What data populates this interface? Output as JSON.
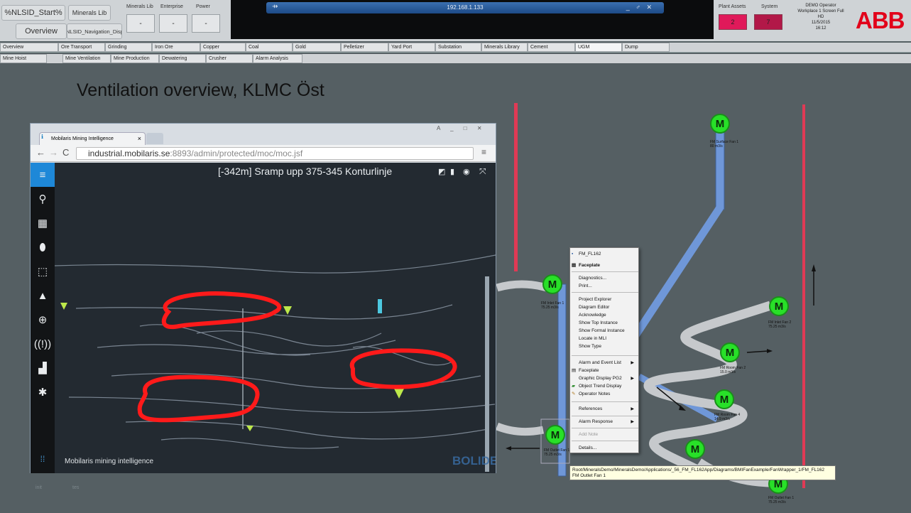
{
  "header": {
    "start_label": "%NLSID_Start%",
    "minerals_lib_label": "Minerals Lib",
    "overview_label": "Overview",
    "nav_label": "%NLSID_Navigation_Displa",
    "dropdowns": [
      {
        "label": "Minerals Lib",
        "value": "-"
      },
      {
        "label": "Enterprise",
        "value": "-"
      },
      {
        "label": "Power",
        "value": "-"
      }
    ],
    "remote_address": "192.168.1.133",
    "remote_controls": "_ ♂ ✕",
    "plant_assets_label": "Plant Assets",
    "plant_assets_count": "2",
    "system_label": "System",
    "system_count": "7",
    "operator_info": [
      "DEMO Operator",
      "Workplace 1 Screen Full",
      "HD",
      "11/5/2015",
      "16:12"
    ],
    "logo": "ABB"
  },
  "tabs_row1": [
    "Overview",
    "Ore Transport",
    "Grinding",
    "Iron Ore",
    "Copper",
    "Coal",
    "Gold",
    "Pelletizer",
    "Yard Port",
    "Substation",
    "Minerals Library",
    "Cement",
    "UGM",
    "Dump"
  ],
  "tabs_row2": [
    "Mine Hoist",
    "Mine Ventilation",
    "Mine Production",
    "Dewatering",
    "Crusher",
    "Alarm Analysis"
  ],
  "page_title": "Ventilation overview, KLMC Öst",
  "browser": {
    "tab_title": "Mobilaris Mining Intelligence",
    "tab_close": "×",
    "window_controls": "A _ □ ✕",
    "url_host": "industrial.mobilaris.se",
    "url_path": ":8893/admin/protected/moc/moc.jsf",
    "map_title": "[-342m] Sramp upp 375-345 Konturlinje",
    "footer": "Mobilaris mining intelligence",
    "watermark": "BOLIDEN"
  },
  "fans": [
    {
      "name": "FM Surface Fan 1",
      "flow": "80",
      "unit": "m3/s"
    },
    {
      "name": "FM Inlet Fan 1",
      "flow": "75.25",
      "unit": "m3/s"
    },
    {
      "name": "FM Inlet Fan 2",
      "flow": "75.25",
      "unit": "m3/s"
    },
    {
      "name": "FM Room Fan 2",
      "flow": "15.0",
      "unit": "m3/s"
    },
    {
      "name": "FM Room Fan 4",
      "flow": "14.9",
      "unit": "m3/s"
    },
    {
      "name": "FM Outlet Fan 1",
      "flow": "75.25",
      "unit": "m3/s"
    }
  ],
  "motor_symbol": "M",
  "context_menu": {
    "header": "FM_FL162",
    "items": [
      "Faceplate",
      "Diagnostics...",
      "Print...",
      "Project Explorer",
      "Diagram Editor",
      "Acknowledge",
      "Show Top Instance",
      "Show Formal Instance",
      "Locate in MLI",
      "Show Type",
      "Alarm and Event List",
      "Faceplate",
      "Graphic Display PG2",
      "Object Trend Display",
      "Operator Notes",
      "References",
      "Alarm Response",
      "Add Note",
      "Details..."
    ]
  },
  "tooltip": {
    "path": "Root/MineralsDemo/MineralsDemo/Applications/_56_FM_FL162App/Diagrams/BMIFanExample/FanWrapper_1/FM_FL162",
    "object": "FM Outlet Fan 1"
  },
  "faint_labels": [
    "init",
    "tes"
  ],
  "colors": {
    "alarm_tile_1": "#e0195a",
    "alarm_tile_2": "#b21848",
    "pipe_blue": "#6f97d8",
    "pipe_red": "#e03a55",
    "motor_green": "#28e028",
    "annotation_red": "#ff1a1a"
  },
  "icons": [
    "menu-icon",
    "search-icon",
    "calendar-icon",
    "location-icon",
    "area-icon",
    "warning-icon",
    "globe-icon",
    "signal-icon",
    "chart-icon",
    "gear-icon",
    "logo-icon"
  ]
}
